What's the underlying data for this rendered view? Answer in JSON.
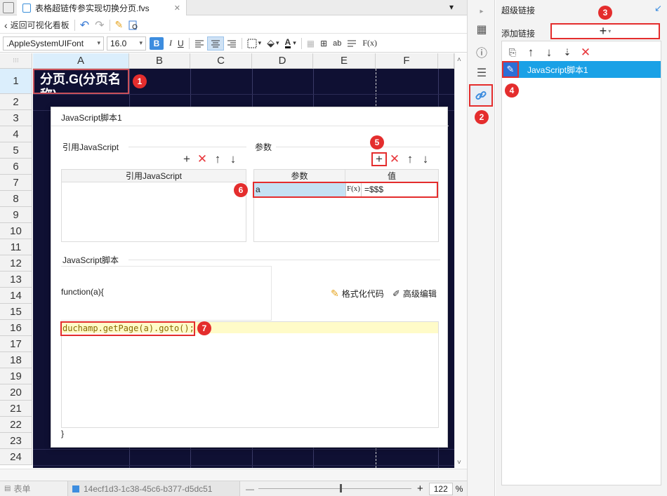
{
  "tab": {
    "title": "表格超链传参实现切换分页.fvs",
    "close": "✕",
    "menu_glyph": "▾"
  },
  "toolbar1": {
    "back_label": "返回可视化看板"
  },
  "toolbar2": {
    "font_name": ".AppleSystemUIFont",
    "font_size": "16.0",
    "bold": "B",
    "italic": "I",
    "underline": "U",
    "text_color_glyph": "A",
    "ab_label": "ab",
    "fx_label": "F(x)"
  },
  "grid": {
    "columns": [
      "A",
      "B",
      "C",
      "D",
      "E",
      "F"
    ],
    "rows": [
      "1",
      "2",
      "3",
      "4",
      "5",
      "6",
      "7",
      "8",
      "9",
      "10",
      "11",
      "12",
      "13",
      "14",
      "15",
      "16",
      "17",
      "18",
      "19",
      "20",
      "21",
      "22",
      "23",
      "24"
    ],
    "cell_a1_text": "分页.G(分页名称)"
  },
  "status": {
    "sheet_tab": "表单",
    "file_id": "14ecf1d3-1c38-45c6-b377-d5dc51",
    "minus": "—",
    "plus": "+",
    "zoom": "122",
    "percent": "%"
  },
  "panel": {
    "title": "超级链接",
    "add_label": "添加链接",
    "add_glyph": "+",
    "list_item": "JavaScript脚本1"
  },
  "dialog": {
    "title": "JavaScript脚本1",
    "ref_section": "引用JavaScript",
    "ref_header": "引用JavaScript",
    "param_section": "参数",
    "param_col": "参数",
    "value_col": "值",
    "param_name": "a",
    "param_fx": "F(x)",
    "param_value": "=$$$",
    "script_section": "JavaScript脚本",
    "func_open": "function(a){",
    "format_label": "格式化代码",
    "advanced_label": "高级编辑",
    "code_line": "duchamp.getPage(a).goto();",
    "func_close": "}"
  },
  "callouts": [
    "1",
    "2",
    "3",
    "4",
    "5",
    "6",
    "7"
  ],
  "colors": {
    "accent": "#3d8ddf",
    "callout": "#e42d2d",
    "sheet_bg": "#0f1033",
    "highlight": "#fffbc8",
    "selection": "#c5e1f3"
  }
}
